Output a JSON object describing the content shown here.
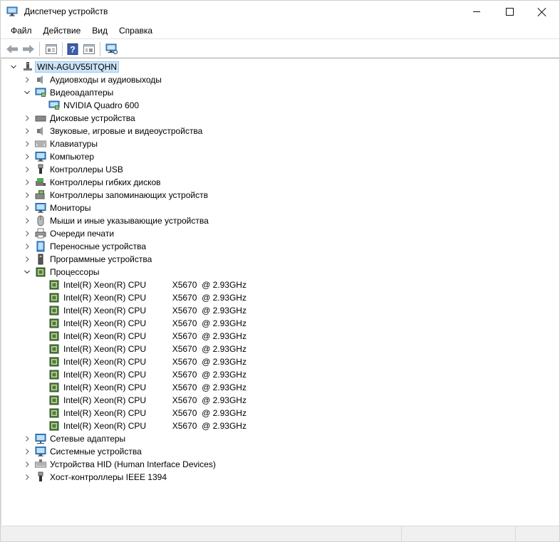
{
  "window": {
    "title": "Диспетчер устройств"
  },
  "menu": [
    {
      "label": "Файл"
    },
    {
      "label": "Действие"
    },
    {
      "label": "Вид"
    },
    {
      "label": "Справка"
    }
  ],
  "toolbar": {
    "buttons": [
      "back-icon",
      "forward-icon",
      "properties-icon",
      "help-icon",
      "update-driver-icon",
      "scan-hardware-icon"
    ]
  },
  "tree": {
    "root": "WIN-AGUV55ITQHN",
    "categories": [
      {
        "label": "Аудиовходы и аудиовыходы",
        "expanded": false,
        "icon": "audio-icon"
      },
      {
        "label": "Видеоадаптеры",
        "expanded": true,
        "icon": "display-adapter-icon",
        "children": [
          "NVIDIA Quadro 600"
        ]
      },
      {
        "label": "Дисковые устройства",
        "expanded": false,
        "icon": "disk-icon"
      },
      {
        "label": "Звуковые, игровые и видеоустройства",
        "expanded": false,
        "icon": "sound-icon"
      },
      {
        "label": "Клавиатуры",
        "expanded": false,
        "icon": "keyboard-icon"
      },
      {
        "label": "Компьютер",
        "expanded": false,
        "icon": "computer-icon"
      },
      {
        "label": "Контроллеры USB",
        "expanded": false,
        "icon": "usb-icon"
      },
      {
        "label": "Контроллеры гибких дисков",
        "expanded": false,
        "icon": "floppy-icon"
      },
      {
        "label": "Контроллеры запоминающих устройств",
        "expanded": false,
        "icon": "storage-controller-icon"
      },
      {
        "label": "Мониторы",
        "expanded": false,
        "icon": "monitor-icon"
      },
      {
        "label": "Мыши и иные указывающие устройства",
        "expanded": false,
        "icon": "mouse-icon"
      },
      {
        "label": "Очереди печати",
        "expanded": false,
        "icon": "printer-icon"
      },
      {
        "label": "Переносные устройства",
        "expanded": false,
        "icon": "portable-device-icon"
      },
      {
        "label": "Программные устройства",
        "expanded": false,
        "icon": "software-device-icon"
      },
      {
        "label": "Процессоры",
        "expanded": true,
        "icon": "processor-icon",
        "children": [
          "Intel(R) Xeon(R) CPU           X5670  @ 2.93GHz",
          "Intel(R) Xeon(R) CPU           X5670  @ 2.93GHz",
          "Intel(R) Xeon(R) CPU           X5670  @ 2.93GHz",
          "Intel(R) Xeon(R) CPU           X5670  @ 2.93GHz",
          "Intel(R) Xeon(R) CPU           X5670  @ 2.93GHz",
          "Intel(R) Xeon(R) CPU           X5670  @ 2.93GHz",
          "Intel(R) Xeon(R) CPU           X5670  @ 2.93GHz",
          "Intel(R) Xeon(R) CPU           X5670  @ 2.93GHz",
          "Intel(R) Xeon(R) CPU           X5670  @ 2.93GHz",
          "Intel(R) Xeon(R) CPU           X5670  @ 2.93GHz",
          "Intel(R) Xeon(R) CPU           X5670  @ 2.93GHz",
          "Intel(R) Xeon(R) CPU           X5670  @ 2.93GHz"
        ]
      },
      {
        "label": "Сетевые адаптеры",
        "expanded": false,
        "icon": "network-adapter-icon"
      },
      {
        "label": "Системные устройства",
        "expanded": false,
        "icon": "system-device-icon"
      },
      {
        "label": "Устройства HID (Human Interface Devices)",
        "expanded": false,
        "icon": "hid-icon"
      },
      {
        "label": "Хост-контроллеры IEEE 1394",
        "expanded": false,
        "icon": "ieee1394-icon"
      }
    ]
  },
  "colors": {
    "selection_bg": "#cce4f7",
    "selection_border": "#99c9ef",
    "icon_blue": "#3a8fd6",
    "chip_green": "#4e7a3a"
  }
}
